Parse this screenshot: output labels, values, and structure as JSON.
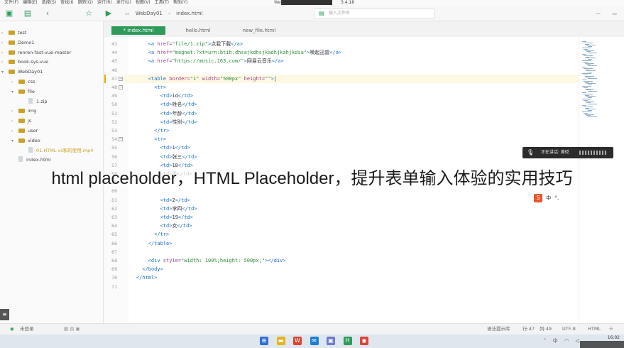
{
  "menubar": {
    "items": [
      "文件(F)",
      "编辑(E)",
      "选择(S)",
      "查找(I)",
      "跳转(G)",
      "运行(R)",
      "发行(U)",
      "视图(V)",
      "工具(T)",
      "帮助(Y)"
    ],
    "app_title": "Web",
    "version": "3.4.18"
  },
  "toolbar": {
    "breadcrumbs": [
      "WebDay01",
      "index.html"
    ],
    "search_placeholder": "输入文件名"
  },
  "sidebar": {
    "items": [
      {
        "label": "test",
        "type": "folder",
        "level": 0,
        "expanded": false
      },
      {
        "label": "Demo1",
        "type": "folder",
        "level": 0,
        "expanded": false
      },
      {
        "label": "renren-fast-vue-master",
        "type": "folder",
        "level": 0,
        "expanded": false
      },
      {
        "label": "book-sys-vue",
        "type": "folder",
        "level": 0,
        "expanded": false
      },
      {
        "label": "WebDay01",
        "type": "folder",
        "level": 0,
        "expanded": true
      },
      {
        "label": "css",
        "type": "folder",
        "level": 1,
        "expanded": false
      },
      {
        "label": "file",
        "type": "folder",
        "level": 1,
        "expanded": true
      },
      {
        "label": "1.zip",
        "type": "file",
        "level": 2
      },
      {
        "label": "img",
        "type": "folder",
        "level": 1,
        "expanded": false
      },
      {
        "label": "js",
        "type": "folder",
        "level": 1,
        "expanded": false
      },
      {
        "label": "user",
        "type": "folder",
        "level": 1,
        "expanded": false
      },
      {
        "label": "video",
        "type": "folder",
        "level": 1,
        "expanded": true
      },
      {
        "label": "01.HTML vs和的使用.mp4",
        "type": "file",
        "level": 2
      },
      {
        "label": "index.html",
        "type": "file",
        "level": 1
      }
    ]
  },
  "tabs": [
    {
      "label": "* index.html",
      "active": true
    },
    {
      "label": "hello.html",
      "active": false
    },
    {
      "label": "new_file.html",
      "active": false
    }
  ],
  "editor": {
    "lines": [
      {
        "n": "43",
        "fold": false,
        "indent": 6,
        "tokens": [
          [
            "tag",
            "<a "
          ],
          [
            "attr",
            "href="
          ],
          [
            "str",
            "\"file/1.zip\""
          ],
          [
            "tag",
            ">"
          ],
          [
            "",
            "点我下载"
          ],
          [
            "tag",
            "</a>"
          ]
        ]
      },
      {
        "n": "44",
        "fold": false,
        "indent": 6,
        "tokens": [
          [
            "tag",
            "<a "
          ],
          [
            "attr",
            "href="
          ],
          [
            "str",
            "\"magnet:?xt=urn:btih:dhsajkdhsjkadhjkahjkdsa\""
          ],
          [
            "tag",
            ">"
          ],
          [
            "",
            "唤起迅雷"
          ],
          [
            "tag",
            "</a>"
          ]
        ]
      },
      {
        "n": "45",
        "fold": false,
        "indent": 6,
        "tokens": [
          [
            "tag",
            "<a "
          ],
          [
            "attr",
            "href="
          ],
          [
            "str",
            "\"https://music.163.com/\""
          ],
          [
            "tag",
            ">"
          ],
          [
            "",
            "网易云音乐"
          ],
          [
            "tag",
            "</a>"
          ]
        ]
      },
      {
        "n": "46",
        "fold": false,
        "indent": 0,
        "tokens": []
      },
      {
        "n": "47",
        "fold": true,
        "indent": 6,
        "current": true,
        "tokens": [
          [
            "tag",
            "<table "
          ],
          [
            "attr",
            "border="
          ],
          [
            "str",
            "\"1\""
          ],
          [
            "attr",
            " width="
          ],
          [
            "str",
            "\"500px\""
          ],
          [
            "attr",
            " height="
          ],
          [
            "str",
            "\"\""
          ],
          [
            "tag",
            ">"
          ]
        ]
      },
      {
        "n": "48",
        "fold": true,
        "indent": 8,
        "tokens": [
          [
            "tag",
            "<tr>"
          ]
        ]
      },
      {
        "n": "49",
        "fold": false,
        "indent": 10,
        "tokens": [
          [
            "tag",
            "<td>"
          ],
          [
            "",
            "id"
          ],
          [
            "tag",
            "</td>"
          ]
        ]
      },
      {
        "n": "50",
        "fold": false,
        "indent": 10,
        "tokens": [
          [
            "tag",
            "<td>"
          ],
          [
            "",
            "姓名"
          ],
          [
            "tag",
            "</td>"
          ]
        ]
      },
      {
        "n": "51",
        "fold": false,
        "indent": 10,
        "tokens": [
          [
            "tag",
            "<td>"
          ],
          [
            "",
            "年龄"
          ],
          [
            "tag",
            "</td>"
          ]
        ]
      },
      {
        "n": "52",
        "fold": false,
        "indent": 10,
        "tokens": [
          [
            "tag",
            "<td>"
          ],
          [
            "",
            "性别"
          ],
          [
            "tag",
            "</td>"
          ]
        ]
      },
      {
        "n": "53",
        "fold": false,
        "indent": 8,
        "tokens": [
          [
            "tag",
            "</tr>"
          ]
        ]
      },
      {
        "n": "54",
        "fold": true,
        "indent": 8,
        "tokens": [
          [
            "tag",
            "<tr>"
          ]
        ]
      },
      {
        "n": "55",
        "fold": false,
        "indent": 10,
        "tokens": [
          [
            "tag",
            "<td>"
          ],
          [
            "",
            "1"
          ],
          [
            "tag",
            "</td>"
          ]
        ]
      },
      {
        "n": "56",
        "fold": false,
        "indent": 10,
        "tokens": [
          [
            "tag",
            "<td>"
          ],
          [
            "",
            "张三"
          ],
          [
            "tag",
            "</td>"
          ]
        ]
      },
      {
        "n": "57",
        "fold": false,
        "indent": 10,
        "tokens": [
          [
            "tag",
            "<td>"
          ],
          [
            "",
            "18"
          ],
          [
            "tag",
            "</td>"
          ]
        ]
      },
      {
        "n": "58",
        "fold": false,
        "indent": 10,
        "faint": true,
        "tokens": [
          [
            "faint",
            "<td>男</td>"
          ]
        ]
      },
      {
        "n": "59",
        "fold": false,
        "indent": 8,
        "faint": true,
        "tokens": []
      },
      {
        "n": "60",
        "fold": false,
        "indent": 8,
        "faint": true,
        "tokens": []
      },
      {
        "n": "61",
        "fold": false,
        "indent": 10,
        "tokens": [
          [
            "tag",
            "<td>"
          ],
          [
            "",
            "2"
          ],
          [
            "tag",
            "</td>"
          ]
        ]
      },
      {
        "n": "62",
        "fold": false,
        "indent": 10,
        "tokens": [
          [
            "tag",
            "<td>"
          ],
          [
            "",
            "李四"
          ],
          [
            "tag",
            "</td>"
          ]
        ]
      },
      {
        "n": "63",
        "fold": false,
        "indent": 10,
        "tokens": [
          [
            "tag",
            "<td>"
          ],
          [
            "",
            "19"
          ],
          [
            "tag",
            "</td>"
          ]
        ]
      },
      {
        "n": "64",
        "fold": false,
        "indent": 10,
        "tokens": [
          [
            "tag",
            "<td>"
          ],
          [
            "",
            "女"
          ],
          [
            "tag",
            "</td>"
          ]
        ]
      },
      {
        "n": "65",
        "fold": false,
        "indent": 8,
        "tokens": [
          [
            "tag",
            "</tr>"
          ]
        ]
      },
      {
        "n": "66",
        "fold": false,
        "indent": 6,
        "tokens": [
          [
            "tag",
            "</table>"
          ]
        ]
      },
      {
        "n": "67",
        "fold": false,
        "indent": 0,
        "tokens": []
      },
      {
        "n": "68",
        "fold": false,
        "indent": 6,
        "tokens": [
          [
            "tag",
            "<div "
          ],
          [
            "attr",
            "style="
          ],
          [
            "str",
            "\"width: 100%;height: 500px;\""
          ],
          [
            "tag",
            "></div>"
          ]
        ]
      },
      {
        "n": "69",
        "fold": false,
        "indent": 4,
        "tokens": [
          [
            "tag",
            "</body>"
          ]
        ]
      },
      {
        "n": "70",
        "fold": false,
        "indent": 2,
        "tokens": [
          [
            "tag",
            "</html>"
          ]
        ]
      },
      {
        "n": "71",
        "fold": false,
        "indent": 0,
        "tokens": []
      }
    ]
  },
  "overlay": {
    "caption": "html placeholder，HTML Placeholder，提升表单输入体验的实用技巧"
  },
  "voice_popup": {
    "text": "正在讲话: 黄砭"
  },
  "ime": {
    "logo": "S",
    "mode": "中",
    "punct": "°,"
  },
  "statusbar": {
    "login": "未登录",
    "hint": "语法提示库",
    "position": "行:47",
    "column": "列:49",
    "encoding": "UTF-8",
    "language": "HTML"
  },
  "taskbar": {
    "apps": [
      {
        "name": "windows-start-icon",
        "color": "#2f6fd1",
        "glyph": "⊞"
      },
      {
        "name": "file-explorer-icon",
        "color": "#e6b422",
        "glyph": "▬"
      },
      {
        "name": "wps-icon",
        "color": "#d9432f",
        "glyph": "W"
      },
      {
        "name": "mail-icon",
        "color": "#1c7ed6",
        "glyph": "✉"
      },
      {
        "name": "photos-icon",
        "color": "#6a7bd1",
        "glyph": "▣"
      },
      {
        "name": "hbuilder-icon",
        "color": "#2e9b5b",
        "glyph": "H"
      },
      {
        "name": "chrome-icon",
        "color": "#db4437",
        "glyph": "◉"
      }
    ],
    "time": "16:02"
  }
}
